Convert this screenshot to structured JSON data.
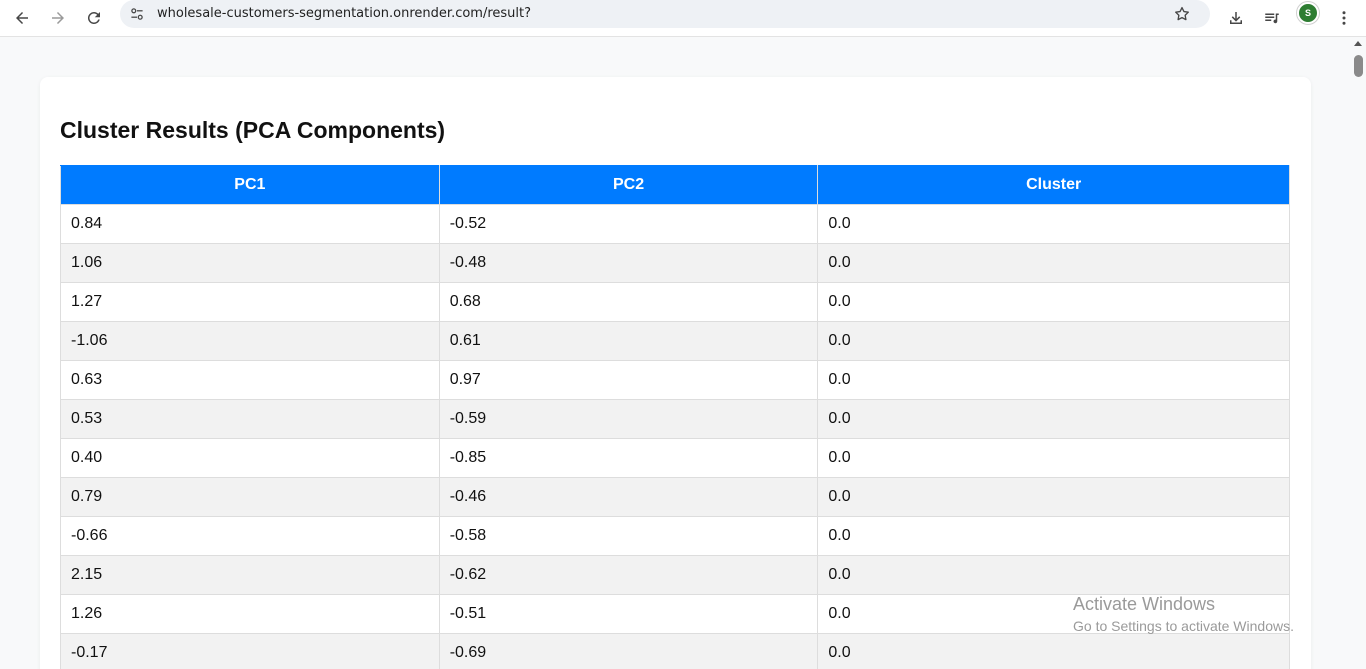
{
  "browser": {
    "url": "wholesale-customers-segmentation.onrender.com/result?",
    "profile_initial": "S"
  },
  "page": {
    "title": "Cluster Results (PCA Components)"
  },
  "table": {
    "headers": [
      "PC1",
      "PC2",
      "Cluster"
    ],
    "rows": [
      [
        "0.84",
        "-0.52",
        "0.0"
      ],
      [
        "1.06",
        "-0.48",
        "0.0"
      ],
      [
        "1.27",
        "0.68",
        "0.0"
      ],
      [
        "-1.06",
        "0.61",
        "0.0"
      ],
      [
        "0.63",
        "0.97",
        "0.0"
      ],
      [
        "0.53",
        "-0.59",
        "0.0"
      ],
      [
        "0.40",
        "-0.85",
        "0.0"
      ],
      [
        "0.79",
        "-0.46",
        "0.0"
      ],
      [
        "-0.66",
        "-0.58",
        "0.0"
      ],
      [
        "2.15",
        "-0.62",
        "0.0"
      ],
      [
        "1.26",
        "-0.51",
        "0.0"
      ],
      [
        "-0.17",
        "-0.69",
        "0.0"
      ]
    ]
  },
  "watermark": {
    "line1": "Activate Windows",
    "line2": "Go to Settings to activate Windows."
  },
  "colors": {
    "header_bg": "#007bff",
    "avatar_bg": "#2e7d32"
  }
}
